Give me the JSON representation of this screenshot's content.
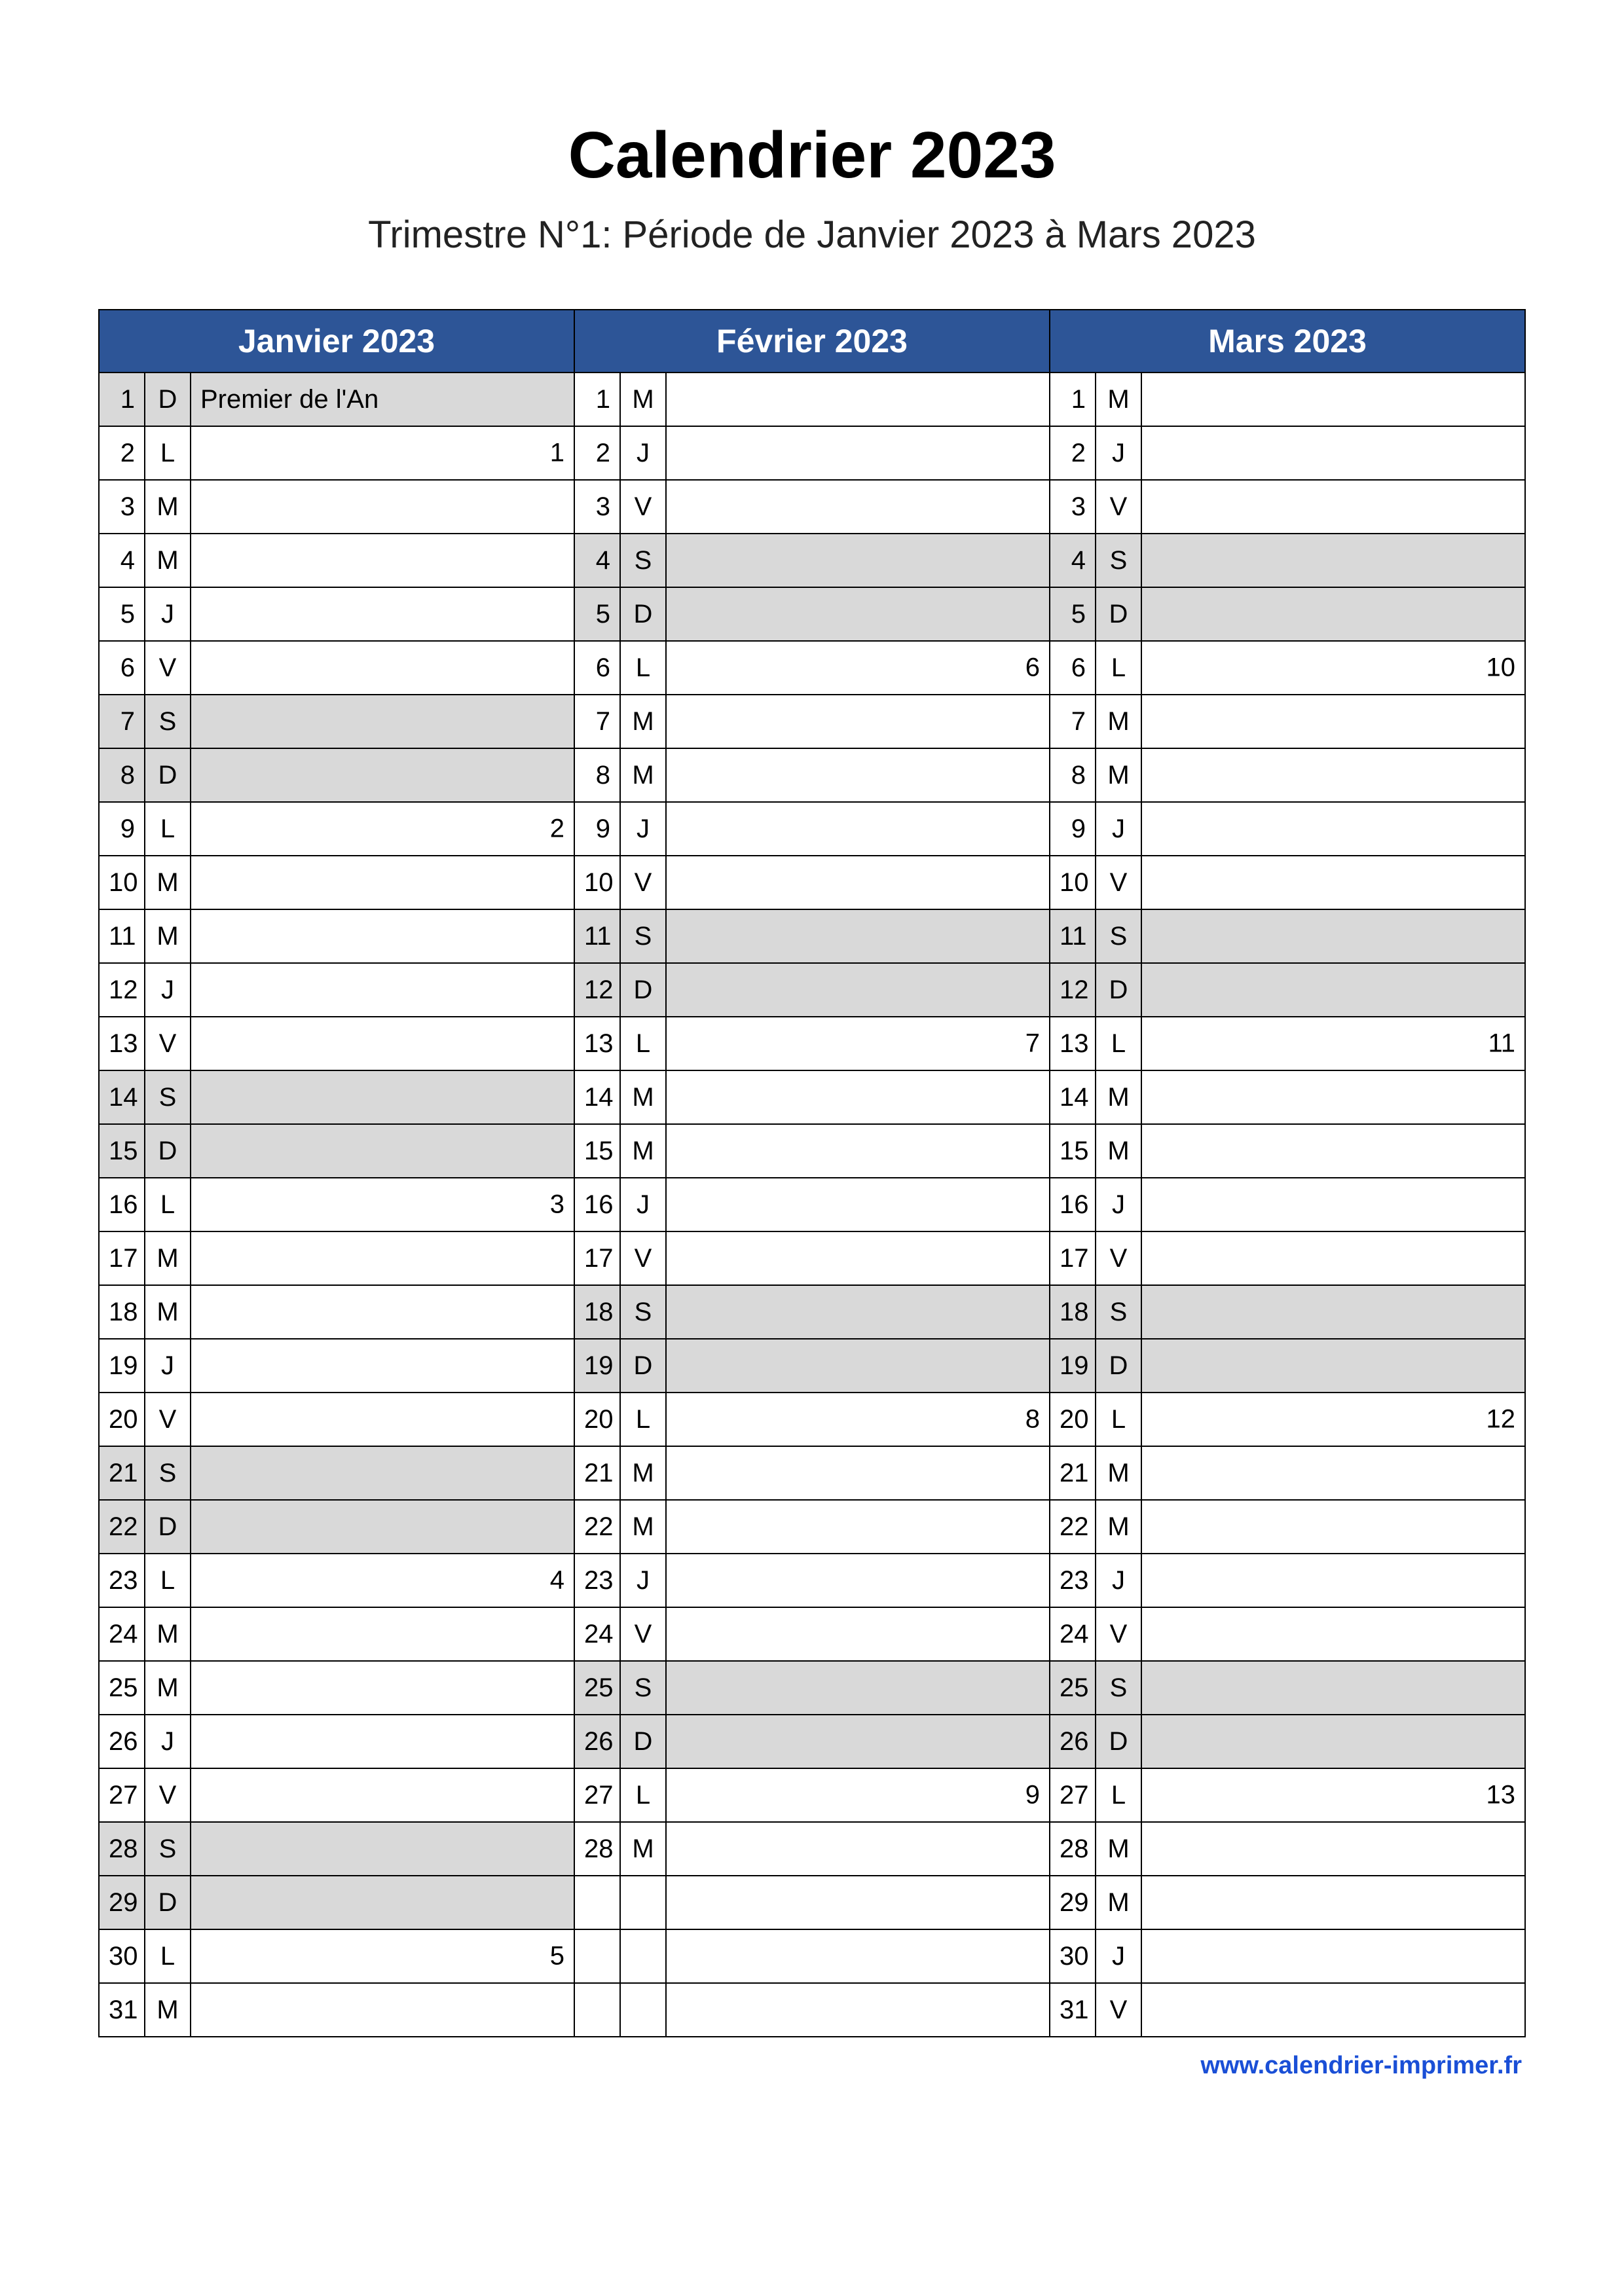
{
  "title": "Calendrier 2023",
  "subtitle": "Trimestre N°1: Période de Janvier 2023 à Mars 2023",
  "footer": "www.calendrier-imprimer.fr",
  "colors": {
    "header_bg": "#2d5597",
    "shade_bg": "#d9d9d9"
  },
  "months": [
    {
      "name": "Janvier 2023",
      "days": [
        {
          "num": 1,
          "dow": "D",
          "note": "Premier de l'An",
          "week": null,
          "shade": true
        },
        {
          "num": 2,
          "dow": "L",
          "note": "",
          "week": 1,
          "shade": false
        },
        {
          "num": 3,
          "dow": "M",
          "note": "",
          "week": null,
          "shade": false
        },
        {
          "num": 4,
          "dow": "M",
          "note": "",
          "week": null,
          "shade": false
        },
        {
          "num": 5,
          "dow": "J",
          "note": "",
          "week": null,
          "shade": false
        },
        {
          "num": 6,
          "dow": "V",
          "note": "",
          "week": null,
          "shade": false
        },
        {
          "num": 7,
          "dow": "S",
          "note": "",
          "week": null,
          "shade": true
        },
        {
          "num": 8,
          "dow": "D",
          "note": "",
          "week": null,
          "shade": true
        },
        {
          "num": 9,
          "dow": "L",
          "note": "",
          "week": 2,
          "shade": false
        },
        {
          "num": 10,
          "dow": "M",
          "note": "",
          "week": null,
          "shade": false
        },
        {
          "num": 11,
          "dow": "M",
          "note": "",
          "week": null,
          "shade": false
        },
        {
          "num": 12,
          "dow": "J",
          "note": "",
          "week": null,
          "shade": false
        },
        {
          "num": 13,
          "dow": "V",
          "note": "",
          "week": null,
          "shade": false
        },
        {
          "num": 14,
          "dow": "S",
          "note": "",
          "week": null,
          "shade": true
        },
        {
          "num": 15,
          "dow": "D",
          "note": "",
          "week": null,
          "shade": true
        },
        {
          "num": 16,
          "dow": "L",
          "note": "",
          "week": 3,
          "shade": false
        },
        {
          "num": 17,
          "dow": "M",
          "note": "",
          "week": null,
          "shade": false
        },
        {
          "num": 18,
          "dow": "M",
          "note": "",
          "week": null,
          "shade": false
        },
        {
          "num": 19,
          "dow": "J",
          "note": "",
          "week": null,
          "shade": false
        },
        {
          "num": 20,
          "dow": "V",
          "note": "",
          "week": null,
          "shade": false
        },
        {
          "num": 21,
          "dow": "S",
          "note": "",
          "week": null,
          "shade": true
        },
        {
          "num": 22,
          "dow": "D",
          "note": "",
          "week": null,
          "shade": true
        },
        {
          "num": 23,
          "dow": "L",
          "note": "",
          "week": 4,
          "shade": false
        },
        {
          "num": 24,
          "dow": "M",
          "note": "",
          "week": null,
          "shade": false
        },
        {
          "num": 25,
          "dow": "M",
          "note": "",
          "week": null,
          "shade": false
        },
        {
          "num": 26,
          "dow": "J",
          "note": "",
          "week": null,
          "shade": false
        },
        {
          "num": 27,
          "dow": "V",
          "note": "",
          "week": null,
          "shade": false
        },
        {
          "num": 28,
          "dow": "S",
          "note": "",
          "week": null,
          "shade": true
        },
        {
          "num": 29,
          "dow": "D",
          "note": "",
          "week": null,
          "shade": true
        },
        {
          "num": 30,
          "dow": "L",
          "note": "",
          "week": 5,
          "shade": false
        },
        {
          "num": 31,
          "dow": "M",
          "note": "",
          "week": null,
          "shade": false
        }
      ]
    },
    {
      "name": "Février 2023",
      "days": [
        {
          "num": 1,
          "dow": "M",
          "note": "",
          "week": null,
          "shade": false
        },
        {
          "num": 2,
          "dow": "J",
          "note": "",
          "week": null,
          "shade": false
        },
        {
          "num": 3,
          "dow": "V",
          "note": "",
          "week": null,
          "shade": false
        },
        {
          "num": 4,
          "dow": "S",
          "note": "",
          "week": null,
          "shade": true
        },
        {
          "num": 5,
          "dow": "D",
          "note": "",
          "week": null,
          "shade": true
        },
        {
          "num": 6,
          "dow": "L",
          "note": "",
          "week": 6,
          "shade": false
        },
        {
          "num": 7,
          "dow": "M",
          "note": "",
          "week": null,
          "shade": false
        },
        {
          "num": 8,
          "dow": "M",
          "note": "",
          "week": null,
          "shade": false
        },
        {
          "num": 9,
          "dow": "J",
          "note": "",
          "week": null,
          "shade": false
        },
        {
          "num": 10,
          "dow": "V",
          "note": "",
          "week": null,
          "shade": false
        },
        {
          "num": 11,
          "dow": "S",
          "note": "",
          "week": null,
          "shade": true
        },
        {
          "num": 12,
          "dow": "D",
          "note": "",
          "week": null,
          "shade": true
        },
        {
          "num": 13,
          "dow": "L",
          "note": "",
          "week": 7,
          "shade": false
        },
        {
          "num": 14,
          "dow": "M",
          "note": "",
          "week": null,
          "shade": false
        },
        {
          "num": 15,
          "dow": "M",
          "note": "",
          "week": null,
          "shade": false
        },
        {
          "num": 16,
          "dow": "J",
          "note": "",
          "week": null,
          "shade": false
        },
        {
          "num": 17,
          "dow": "V",
          "note": "",
          "week": null,
          "shade": false
        },
        {
          "num": 18,
          "dow": "S",
          "note": "",
          "week": null,
          "shade": true
        },
        {
          "num": 19,
          "dow": "D",
          "note": "",
          "week": null,
          "shade": true
        },
        {
          "num": 20,
          "dow": "L",
          "note": "",
          "week": 8,
          "shade": false
        },
        {
          "num": 21,
          "dow": "M",
          "note": "",
          "week": null,
          "shade": false
        },
        {
          "num": 22,
          "dow": "M",
          "note": "",
          "week": null,
          "shade": false
        },
        {
          "num": 23,
          "dow": "J",
          "note": "",
          "week": null,
          "shade": false
        },
        {
          "num": 24,
          "dow": "V",
          "note": "",
          "week": null,
          "shade": false
        },
        {
          "num": 25,
          "dow": "S",
          "note": "",
          "week": null,
          "shade": true
        },
        {
          "num": 26,
          "dow": "D",
          "note": "",
          "week": null,
          "shade": true
        },
        {
          "num": 27,
          "dow": "L",
          "note": "",
          "week": 9,
          "shade": false
        },
        {
          "num": 28,
          "dow": "M",
          "note": "",
          "week": null,
          "shade": false
        }
      ]
    },
    {
      "name": "Mars 2023",
      "days": [
        {
          "num": 1,
          "dow": "M",
          "note": "",
          "week": null,
          "shade": false
        },
        {
          "num": 2,
          "dow": "J",
          "note": "",
          "week": null,
          "shade": false
        },
        {
          "num": 3,
          "dow": "V",
          "note": "",
          "week": null,
          "shade": false
        },
        {
          "num": 4,
          "dow": "S",
          "note": "",
          "week": null,
          "shade": true
        },
        {
          "num": 5,
          "dow": "D",
          "note": "",
          "week": null,
          "shade": true
        },
        {
          "num": 6,
          "dow": "L",
          "note": "",
          "week": 10,
          "shade": false
        },
        {
          "num": 7,
          "dow": "M",
          "note": "",
          "week": null,
          "shade": false
        },
        {
          "num": 8,
          "dow": "M",
          "note": "",
          "week": null,
          "shade": false
        },
        {
          "num": 9,
          "dow": "J",
          "note": "",
          "week": null,
          "shade": false
        },
        {
          "num": 10,
          "dow": "V",
          "note": "",
          "week": null,
          "shade": false
        },
        {
          "num": 11,
          "dow": "S",
          "note": "",
          "week": null,
          "shade": true
        },
        {
          "num": 12,
          "dow": "D",
          "note": "",
          "week": null,
          "shade": true
        },
        {
          "num": 13,
          "dow": "L",
          "note": "",
          "week": 11,
          "shade": false
        },
        {
          "num": 14,
          "dow": "M",
          "note": "",
          "week": null,
          "shade": false
        },
        {
          "num": 15,
          "dow": "M",
          "note": "",
          "week": null,
          "shade": false
        },
        {
          "num": 16,
          "dow": "J",
          "note": "",
          "week": null,
          "shade": false
        },
        {
          "num": 17,
          "dow": "V",
          "note": "",
          "week": null,
          "shade": false
        },
        {
          "num": 18,
          "dow": "S",
          "note": "",
          "week": null,
          "shade": true
        },
        {
          "num": 19,
          "dow": "D",
          "note": "",
          "week": null,
          "shade": true
        },
        {
          "num": 20,
          "dow": "L",
          "note": "",
          "week": 12,
          "shade": false
        },
        {
          "num": 21,
          "dow": "M",
          "note": "",
          "week": null,
          "shade": false
        },
        {
          "num": 22,
          "dow": "M",
          "note": "",
          "week": null,
          "shade": false
        },
        {
          "num": 23,
          "dow": "J",
          "note": "",
          "week": null,
          "shade": false
        },
        {
          "num": 24,
          "dow": "V",
          "note": "",
          "week": null,
          "shade": false
        },
        {
          "num": 25,
          "dow": "S",
          "note": "",
          "week": null,
          "shade": true
        },
        {
          "num": 26,
          "dow": "D",
          "note": "",
          "week": null,
          "shade": true
        },
        {
          "num": 27,
          "dow": "L",
          "note": "",
          "week": 13,
          "shade": false
        },
        {
          "num": 28,
          "dow": "M",
          "note": "",
          "week": null,
          "shade": false
        },
        {
          "num": 29,
          "dow": "M",
          "note": "",
          "week": null,
          "shade": false
        },
        {
          "num": 30,
          "dow": "J",
          "note": "",
          "week": null,
          "shade": false
        },
        {
          "num": 31,
          "dow": "V",
          "note": "",
          "week": null,
          "shade": false
        }
      ]
    }
  ]
}
